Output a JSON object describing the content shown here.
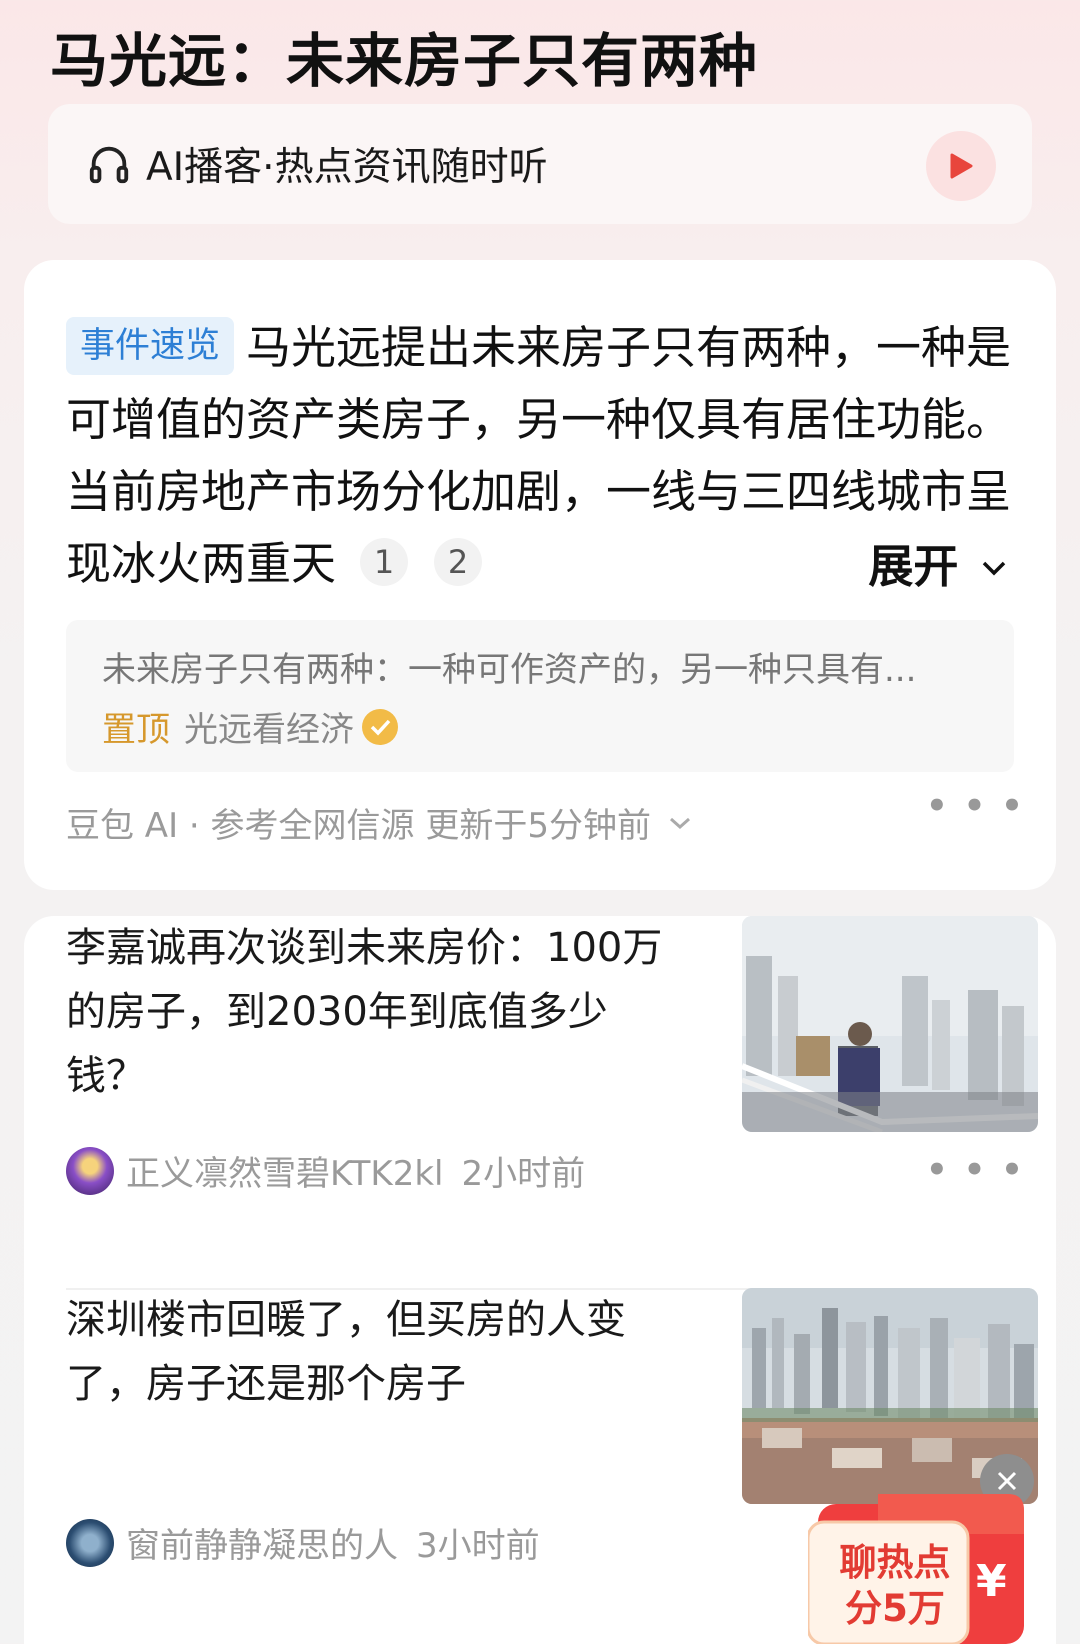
{
  "page_title": "马光远：未来房子只有两种",
  "podcast": {
    "label": "AI播客·热点资讯随时听",
    "icon": "headphones-icon",
    "play_icon": "play-icon"
  },
  "summary_card": {
    "tag": "事件速览",
    "text": "马光远提出未来房子只有两种，一种是可增值的资产类房子，另一种仅具有居住功能。当前房地产市场分化加剧，一线与三四线城市呈现冰火两重天",
    "citations": [
      "1",
      "2"
    ],
    "expand_label": "展开",
    "source": {
      "title": "未来房子只有两种：一种可作资产的，另一种只具有...",
      "pin_label": "置顶",
      "author": "光远看经济"
    },
    "meta": "豆包 AI · 参考全网信源 更新于5分钟前"
  },
  "articles": [
    {
      "title": "李嘉诚再次谈到未来房价：100万的房子，到2030年到底值多少钱？",
      "author": "正义凛然雪碧KTK2kl",
      "time": "2小时前"
    },
    {
      "title": "深圳楼市回暖了，但买房的人变了，房子还是那个房子",
      "author": "窗前静静凝思的人",
      "time": "3小时前"
    }
  ],
  "promo": {
    "text": "聊热点分5万",
    "currency": "¥"
  },
  "colors": {
    "accent_red": "#e8453c",
    "tag_blue": "#2d7fd5",
    "pin_gold": "#d6982c"
  }
}
